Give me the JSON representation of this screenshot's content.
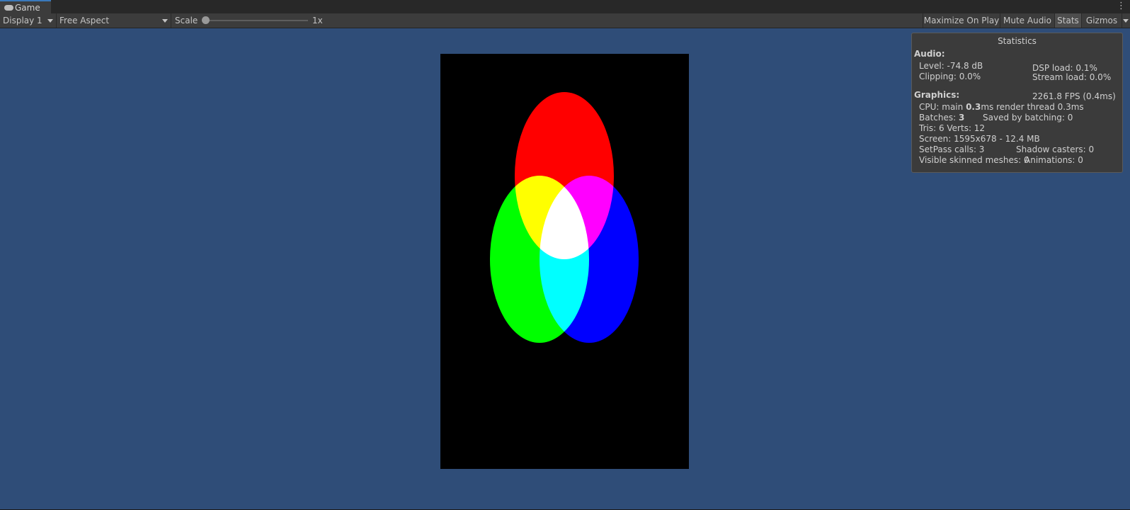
{
  "tab": {
    "label": "Game",
    "icon": "gamepad-icon"
  },
  "toolbar": {
    "display": "Display 1",
    "aspect": "Free Aspect",
    "scale_label": "Scale",
    "scale_value": "1x",
    "maximize": "Maximize On Play",
    "mute": "Mute Audio",
    "stats": "Stats",
    "gizmos": "Gizmos"
  },
  "stats": {
    "title": "Statistics",
    "audio_header": "Audio:",
    "level": "Level: -74.8 dB",
    "clipping": "Clipping: 0.0%",
    "dsp": "DSP load: 0.1%",
    "stream": "Stream load: 0.0%",
    "graphics_header": "Graphics:",
    "fps": "2261.8 FPS (0.4ms)",
    "cpu_prefix": "CPU: main ",
    "cpu_main": "0.3",
    "cpu_suffix": "ms  render thread 0.3ms",
    "batches_prefix": "Batches: ",
    "batches": "3",
    "saved": "Saved by batching: 0",
    "tris": "Tris: 6   Verts: 12",
    "screen": "Screen: 1595x678 - 12.4 MB",
    "setpass": "SetPass calls: 3",
    "shadow": "Shadow casters: 0",
    "skinned": "Visible skinned meshes: 0",
    "animations": "Animations: 0"
  },
  "colors": {
    "game_background": "#2f4d78",
    "canvas_background": "#000000",
    "red": "#ff0000",
    "green": "#00ff00",
    "blue": "#0000ff",
    "tab_accent": "#3a79bb"
  }
}
